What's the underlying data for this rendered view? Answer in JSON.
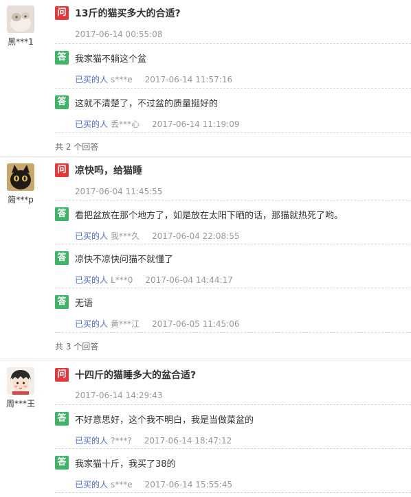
{
  "buyer_label": "已买的人",
  "questions": [
    {
      "user": "黑***1",
      "avatar_icon": "cat-photo-avatar",
      "title": "13斤的猫买多大的合适?",
      "time": "2017-06-14 00:55:08",
      "answers": [
        {
          "text": "我家猫不躺这个盆",
          "who": "s***e",
          "time": "2017-06-14 11:57:16"
        },
        {
          "text": "这就不清楚了，不过盆的质量挺好的",
          "who": "丢***心",
          "time": "2017-06-14 11:19:09"
        }
      ],
      "total": "共 2 个回答"
    },
    {
      "user": "简***p",
      "avatar_icon": "black-cat-avatar",
      "title": "凉快吗，给猫睡",
      "time": "2017-06-04 11:45:55",
      "answers": [
        {
          "text": "看把盆放在那个地方了，如是放在太阳下晒的话，那猫就热死了哟。",
          "who": "我***久",
          "time": "2017-06-04 22:08:55"
        },
        {
          "text": "凉快不凉快问猫不就懂了",
          "who": "L***0",
          "time": "2017-06-04 14:44:17"
        },
        {
          "text": "无语",
          "who": "黄***江",
          "time": "2017-06-05 11:45:06"
        }
      ],
      "total": "共 3 个回答"
    },
    {
      "user": "周***王",
      "avatar_icon": "cartoon-girl-avatar",
      "title": "十四斤的猫睡多大的盆合适?",
      "time": "2017-06-14 14:29:43",
      "answers": [
        {
          "text": "不好意思好，这个我不明白，我是当做菜盆的",
          "who": "?***?",
          "time": "2017-06-14 18:47:12"
        },
        {
          "text": "我家猫十斤，我买了38的",
          "who": "s***e",
          "time": "2017-06-14 15:55:45"
        }
      ],
      "total": ""
    }
  ],
  "tags": {
    "question": "问",
    "answer": "答"
  },
  "colors": {
    "question_tag": "#e4393c",
    "answer_tag": "#3cb564",
    "buyer_link": "#4a6fd0",
    "muted": "#999999"
  }
}
